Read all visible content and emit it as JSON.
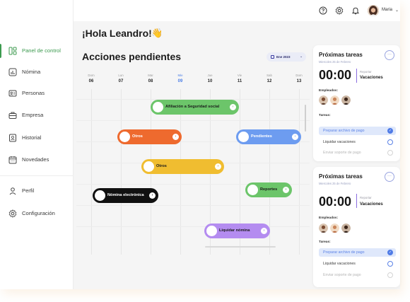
{
  "sidebar": {
    "items": [
      {
        "label": "Panel de control",
        "icon": "dashboard-icon",
        "active": true
      },
      {
        "label": "Nómina",
        "icon": "payroll-icon"
      },
      {
        "label": "Personas",
        "icon": "people-card-icon"
      },
      {
        "label": "Empresa",
        "icon": "briefcase-icon"
      },
      {
        "label": "Historial",
        "icon": "history-icon"
      },
      {
        "label": "Novedades",
        "icon": "calendar-icon"
      },
      {
        "label": "Perfil",
        "icon": "user-icon"
      },
      {
        "label": "Configuración",
        "icon": "gear-icon"
      }
    ]
  },
  "topbar": {
    "icons": [
      "help-icon",
      "settings-icon",
      "notification-bell-icon"
    ],
    "user_name": "Maria",
    "chevron": "⌄"
  },
  "greeting": "¡Hola Leandro!",
  "wave_emoji": "👋",
  "section_title": "Acciones pendientes",
  "month_selector": {
    "label": "Ene 2023",
    "chevron": "⌄"
  },
  "calendar": {
    "days": [
      {
        "name": "Dom",
        "num": "06"
      },
      {
        "name": "Lun",
        "num": "07"
      },
      {
        "name": "Mar",
        "num": "08"
      },
      {
        "name": "Mie",
        "num": "09",
        "today": true
      },
      {
        "name": "Jue",
        "num": "10"
      },
      {
        "name": "Vie",
        "num": "11"
      },
      {
        "name": "Sab",
        "num": "12"
      },
      {
        "name": "Dom",
        "num": "13"
      }
    ],
    "events": [
      {
        "label": "Afiliación a Seguridad social",
        "color": "#6cc56a",
        "text_color": "#1b1b1b",
        "arrow": "›"
      },
      {
        "label": "Otros",
        "color": "#ee6a2e",
        "text_color": "#ffffff",
        "arrow": "›"
      },
      {
        "label": "Pendientes",
        "color": "#6d9cf0",
        "text_color": "#ffffff",
        "arrow": "›"
      },
      {
        "label": "Otros",
        "color": "#f0bd30",
        "text_color": "#1b1b1b",
        "arrow": "›"
      },
      {
        "label": "Reportes",
        "color": "#6cc56a",
        "text_color": "#1b1b1b",
        "arrow": "›"
      },
      {
        "label": "Nómina electrónica",
        "color": "#111111",
        "text_color": "#ffffff",
        "arrow": "›"
      },
      {
        "label": "Liquidar nómina",
        "color": "#b48cf0",
        "text_color": "#1b1b1b",
        "arrow": "›"
      }
    ]
  },
  "task_cards": [
    {
      "title": "Próximas tareas",
      "date": "Miercoles 25 de Febrero",
      "more": "···",
      "time": "00:00",
      "action_label": "Reportar",
      "action_value": "Vacaciones",
      "employees_label": "Empleados:",
      "tasks_label": "Tareas:",
      "tasks": [
        {
          "label": "Preparar archivo de pago",
          "state": "done"
        },
        {
          "label": "Liquidar vacaciones",
          "state": "normal"
        },
        {
          "label": "Enviar soporte de pago",
          "state": "faded"
        }
      ]
    },
    {
      "title": "Próximas tareas",
      "date": "Miercoles 25 de Febrero",
      "more": "···",
      "time": "00:00",
      "action_label": "Reportar",
      "action_value": "Vacaciones",
      "employees_label": "Empleados:",
      "tasks_label": "Tareas:",
      "tasks": [
        {
          "label": "Preparar archivo de pago",
          "state": "done"
        },
        {
          "label": "Liquidar vacaciones",
          "state": "normal"
        },
        {
          "label": "Enviar soporte de pago",
          "state": "faded"
        }
      ]
    }
  ],
  "colors": {
    "accent_green": "#3c9a4f",
    "accent_blue": "#4f7be6",
    "accent_purple": "#8a6de0"
  }
}
